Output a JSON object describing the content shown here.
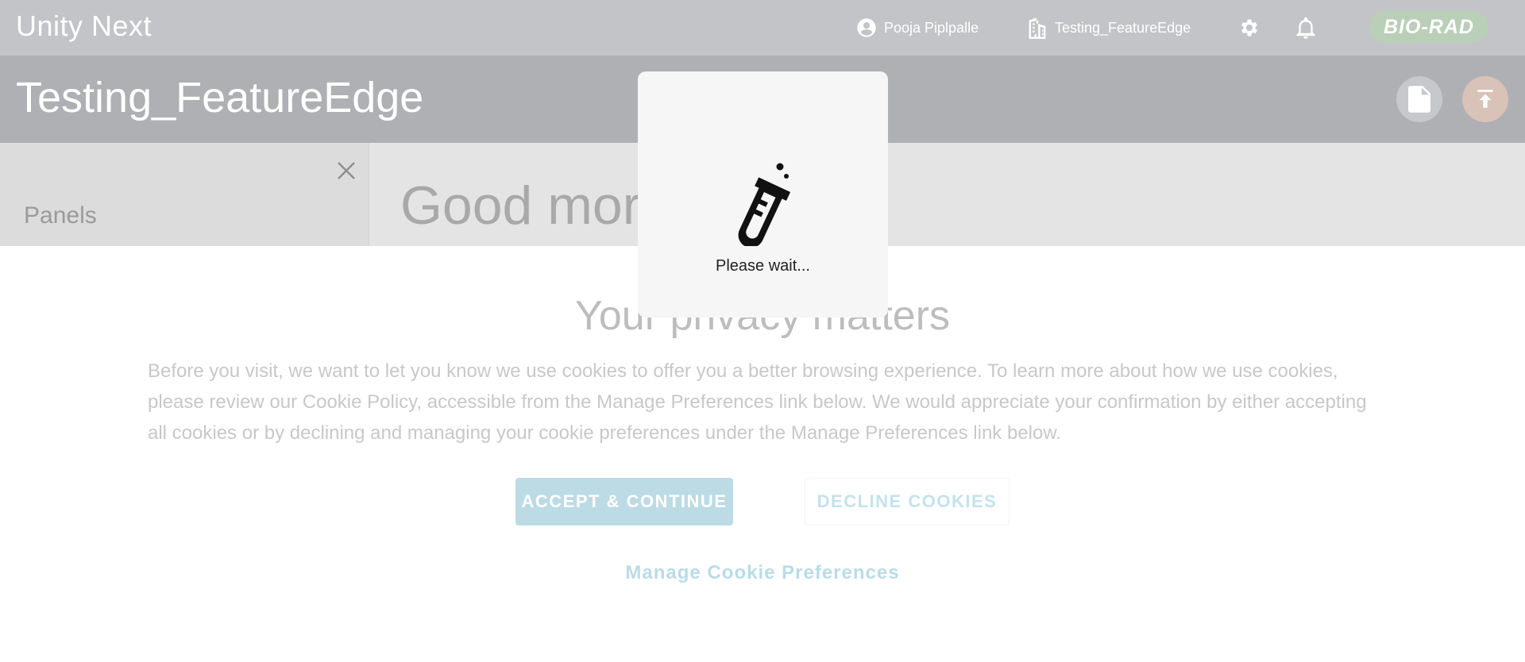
{
  "app": {
    "title": "Unity Next"
  },
  "topbar": {
    "user_name": "Pooja Piplpalle",
    "lab_name": "Testing_FeatureEdge",
    "logo_text": "BIO-RAD"
  },
  "subheader": {
    "lab_title": "Testing_FeatureEdge"
  },
  "side_panel": {
    "title": "Panels"
  },
  "main": {
    "greeting": "Good morning"
  },
  "cookie": {
    "title": "Your privacy matters",
    "text": "Before you visit, we want to let you know we use cookies to offer you a better browsing experience. To learn more about how we use cookies, please review our Cookie Policy, accessible from the Manage Preferences link below. We would appreciate your confirmation by either accepting all cookies or by declining and managing your cookie preferences under the Manage Preferences link below.",
    "accept_label": "ACCEPT & CONTINUE",
    "decline_label": "DECLINE COOKIES",
    "manage_label": "Manage Cookie Preferences"
  },
  "loading": {
    "text": "Please wait..."
  },
  "icons": {
    "user": "account-circle-icon",
    "lab": "building-icon",
    "settings": "gear-icon",
    "notifications": "bell-icon",
    "document": "document-icon",
    "upload": "upload-icon",
    "close": "close-icon",
    "loading": "test-tube-icon"
  },
  "colors": {
    "topbar": "#c3c4c7",
    "subheader": "#aeb0b4",
    "accept": "#bcdbe5",
    "manage_link": "#b9dce7",
    "logo": "#b9cfb8"
  }
}
